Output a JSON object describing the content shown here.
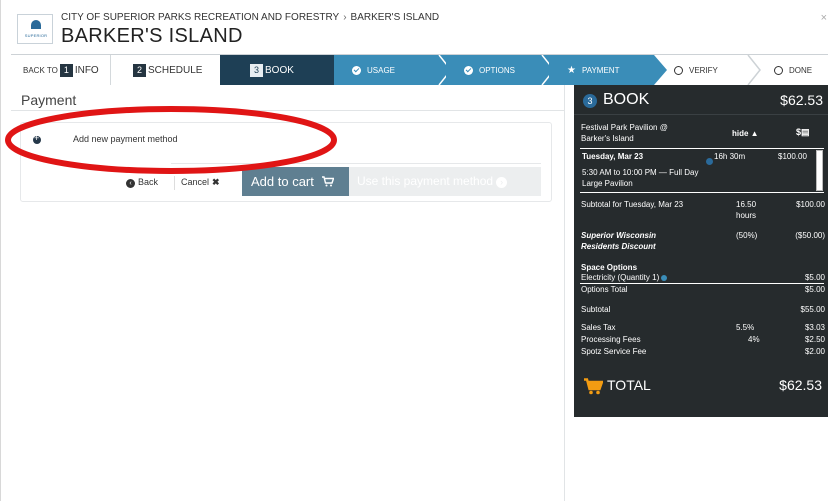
{
  "header": {
    "breadcrumb_org": "CITY OF SUPERIOR PARKS RECREATION AND FORESTRY",
    "breadcrumb_place": "BARKER'S ISLAND",
    "title": "BARKER'S ISLAND",
    "logo_text": "SUPERIOR"
  },
  "steps": [
    {
      "prefix": "BACK TO",
      "number": "1",
      "label": "INFO"
    },
    {
      "number": "2",
      "label": "SCHEDULE"
    },
    {
      "number": "3",
      "label": "BOOK"
    },
    {
      "label": "USAGE"
    },
    {
      "label": "OPTIONS"
    },
    {
      "label": "PAYMENT"
    },
    {
      "label": "VERIFY"
    },
    {
      "label": "DONE"
    }
  ],
  "payment": {
    "section_title": "Payment",
    "add_method": "Add new payment method",
    "back": "Back",
    "cancel": "Cancel",
    "add_to_cart": "Add to cart",
    "use_method": "Use this payment method"
  },
  "summary": {
    "step_number": "3",
    "title": "BOOK",
    "header_amount": "$62.53",
    "facility_name": "Festival Park Pavilion @ Barker's Island",
    "hide_label": "hide ▲",
    "date_bold": "Tuesday, Mar 23",
    "time_range": "5:30 AM to 10:00 PM — Full Day Large Pavilion",
    "duration": "16h 30m",
    "date_price": "$100.00",
    "subtotal_day_label": "Subtotal for Tuesday, Mar 23",
    "subtotal_day_hours": "16.50 hours",
    "subtotal_day_amount": "$100.00",
    "discount_label": "Superior Wisconsin Residents Discount",
    "discount_pct": "(50%)",
    "discount_amount": "($50.00)",
    "space_options_label": "Space Options",
    "electricity_label": "Electricity (Quantity 1)",
    "electricity_amount": "$5.00",
    "options_total_label": "Options Total",
    "options_total_amount": "$5.00",
    "subtotal_label": "Subtotal",
    "subtotal_amount": "$55.00",
    "sales_tax_label": "Sales Tax",
    "sales_tax_pct": "5.5%",
    "sales_tax_amount": "$3.03",
    "processing_label": "Processing Fees",
    "processing_pct": "4%",
    "processing_amount": "$2.50",
    "service_label": "Spotz Service Fee",
    "service_amount": "$2.00",
    "total_label": "TOTAL",
    "total_amount": "$62.53"
  },
  "colors": {
    "step_active": "#1e3f55",
    "step_complete": "#3a8db8",
    "summary_bg": "#262b2d",
    "cart_icon": "#f39c12",
    "annotation": "#e01515"
  }
}
